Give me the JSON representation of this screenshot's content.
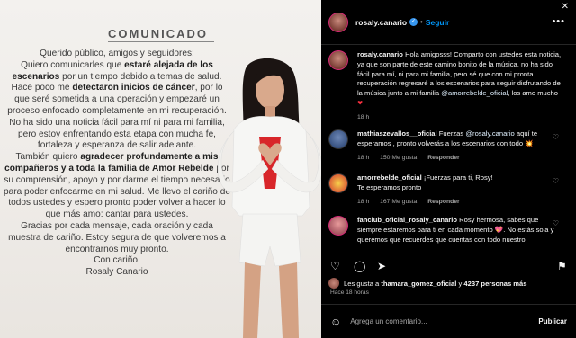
{
  "photo": {
    "title": "COMUNICADO",
    "lines": [
      "Querido público, amigos y seguidores:",
      "Quiero comunicarles que",
      "estaré alejada de los escenarios",
      "por un tiempo debido a temas de salud.",
      "Hace poco me",
      "detectaron inicios de cáncer",
      ", por lo que seré sometida a una operación y empezaré un proceso enfocado completamente en mi recuperación.",
      "No ha sido una noticia fácil para mí ni para mi familia, pero estoy enfrentando esta etapa con mucha fe, fortaleza y esperanza de salir adelante.",
      "También quiero",
      "agradecer profundamente a mis compañeros y a toda la familia de Amor Rebelde",
      "por su comprensión, apoyo y por darme el tiempo necesario para poder enfocarme en mi salud. Me llevo el cariño de todos ustedes y espero pronto poder volver a hacer lo que más amo: cantar para ustedes.",
      "Gracias por cada mensaje, cada oración y cada muestra de cariño. Estoy segura de que volveremos a encontrarnos muy pronto.",
      "Con cariño,",
      "Rosaly Canario"
    ]
  },
  "ig": {
    "header": {
      "username": "rosaly.canario",
      "separator": "•",
      "follow_label": "Seguir",
      "more": "•••"
    },
    "comments": [
      {
        "username": "rosaly.canario",
        "text_a": "Hola amigosss! Comparto con ustedes esta noticia, ya que son parte de este camino bonito de la música, no ha sido fácil para mí, ni para mi familia, pero sé que con mi pronta recuperación regresaré a los escenarios para seguir disfrutando de la música junto a mi familia",
        "mention": "@amorrebelde_oficial",
        "text_b": ", los amo mucho",
        "emoji": "❤",
        "time": "18 h"
      },
      {
        "username": "mathiaszevallos__oficial",
        "text_a": "Fuerzas",
        "mention": "@rosaly.canario",
        "text_b": "aquí te esperamos , pronto volverás a los escenarios con todo",
        "emoji": "💥",
        "time": "18 h",
        "likes": "150 Me gusta",
        "reply": "Responder"
      },
      {
        "username": "amorrebelde_oficial",
        "text_a": "¡Fuerzas para ti, Rosy!",
        "text_b": "Te esperamos pronto",
        "time": "18 h",
        "likes": "167 Me gusta",
        "reply": "Responder"
      },
      {
        "username": "fanclub_oficial_rosaly_canario",
        "text_a": "Rosy hermosa, sabes que siempre estaremos para ti en cada momento",
        "emoji": "💖",
        "text_b": ". No estás sola y queremos que recuerdes que cuentas con todo nuestro",
        "time": "",
        "likes": "",
        "reply": ""
      }
    ],
    "likes_text_prefix": "Les gusta a",
    "likes_user": "thamara_gomez_oficial",
    "likes_text_mid": "y",
    "likes_count": "4237 personas más",
    "time_ago": "Hace 18 horas",
    "add_comment_placeholder": "Agrega un comentario...",
    "publish_label": "Publicar"
  }
}
